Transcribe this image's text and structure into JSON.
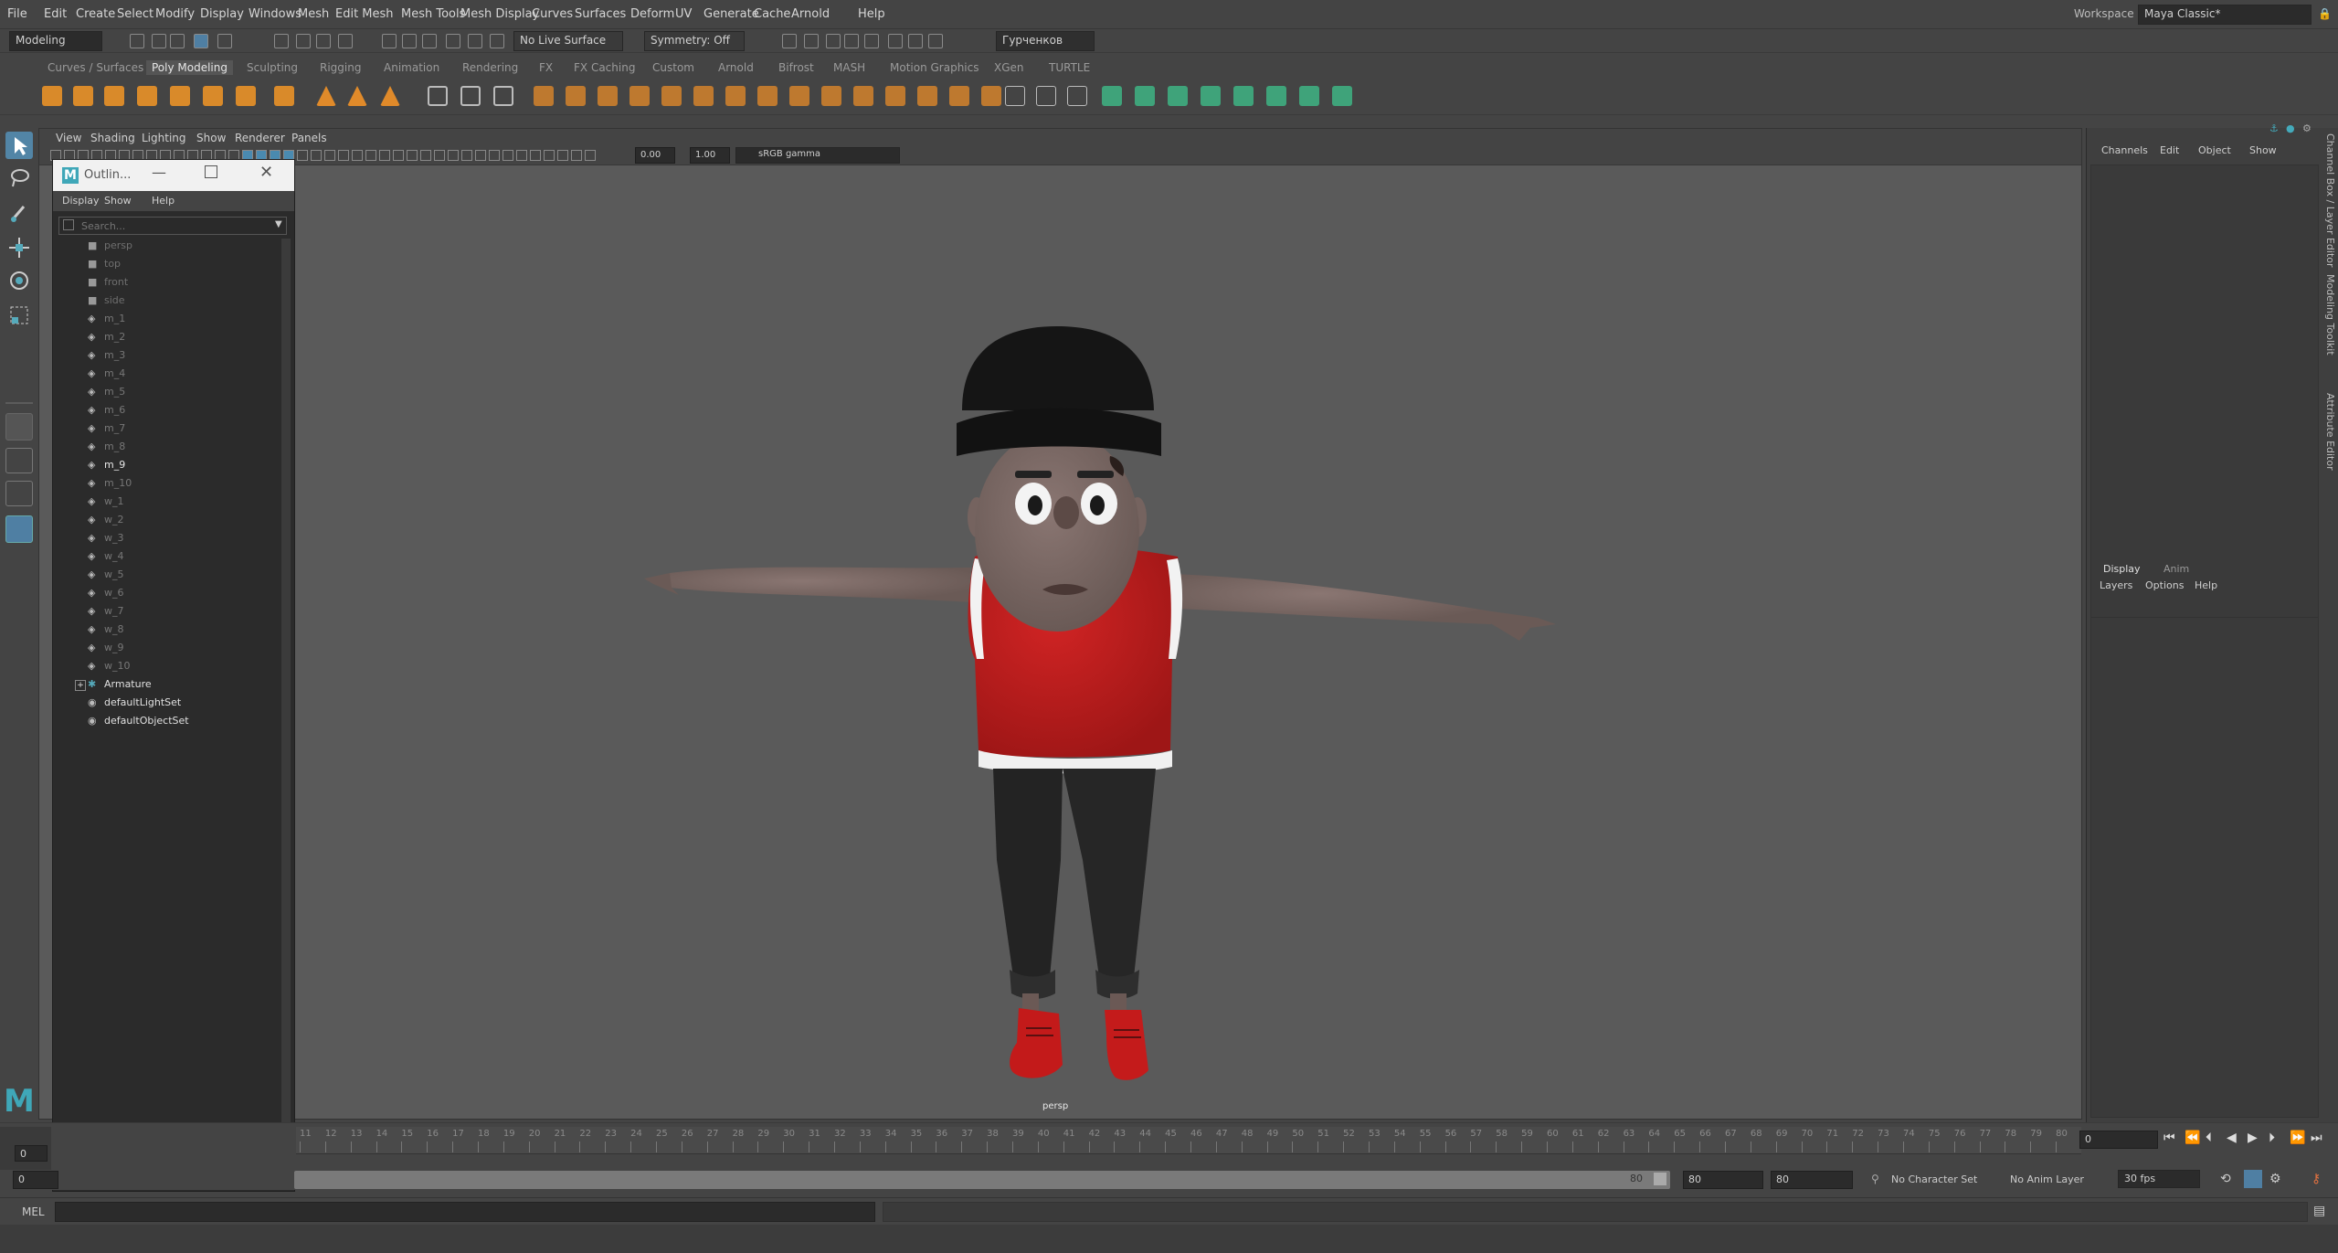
{
  "menus": [
    "File",
    "Edit",
    "Create",
    "Select",
    "Modify",
    "Display",
    "Windows",
    "Mesh",
    "Edit Mesh",
    "Mesh Tools",
    "Mesh Display",
    "Curves",
    "Surfaces",
    "Deform",
    "UV",
    "Generate",
    "Cache",
    "Arnold",
    "Help"
  ],
  "workspace": {
    "label": "Workspace :",
    "value": "Maya Classic*"
  },
  "status": {
    "mode": "Modeling",
    "live": "No Live Surface",
    "symmetry": "Symmetry: Off",
    "user": "Гурченков"
  },
  "shelf_tabs": [
    "Curves / Surfaces",
    "Poly Modeling",
    "Sculpting",
    "Rigging",
    "Animation",
    "Rendering",
    "FX",
    "FX Caching",
    "Custom",
    "Arnold",
    "Bifrost",
    "MASH",
    "Motion Graphics",
    "XGen",
    "TURTLE"
  ],
  "shelf_active": "Poly Modeling",
  "viewport": {
    "menus": [
      "View",
      "Shading",
      "Lighting",
      "Show",
      "Renderer",
      "Panels"
    ],
    "exposure": "0.00",
    "gamma": "1.00",
    "colorspace": "sRGB gamma",
    "camera": "persp"
  },
  "outliner": {
    "title": "Outlin...",
    "menus": [
      "Display",
      "Show",
      "Help"
    ],
    "search_placeholder": "Search...",
    "cameras": [
      "persp",
      "top",
      "front",
      "side"
    ],
    "meshes": [
      "m_1",
      "m_2",
      "m_3",
      "m_4",
      "m_5",
      "m_6",
      "m_7",
      "m_8",
      "m_9",
      "m_10",
      "w_1",
      "w_2",
      "w_3",
      "w_4",
      "w_5",
      "w_6",
      "w_7",
      "w_8",
      "w_9",
      "w_10"
    ],
    "selected": "m_9",
    "others": [
      "Armature",
      "defaultLightSet",
      "defaultObjectSet"
    ]
  },
  "channel_box": {
    "menus": [
      "Channels",
      "Edit",
      "Object",
      "Show"
    ]
  },
  "layer_editor": {
    "tabs": [
      "Display",
      "Anim"
    ],
    "menus": [
      "Layers",
      "Options",
      "Help"
    ]
  },
  "side_tabs": [
    "Channel Box / Layer Editor",
    "Modeling Toolkit",
    "Attribute Editor"
  ],
  "timeline": {
    "ticks": [
      "11",
      "12",
      "13",
      "14",
      "15",
      "16",
      "17",
      "18",
      "19",
      "20",
      "21",
      "22",
      "23",
      "24",
      "25",
      "26",
      "27",
      "28",
      "29",
      "30",
      "31",
      "32",
      "33",
      "34",
      "35",
      "36",
      "37",
      "38",
      "39",
      "40",
      "41",
      "42",
      "43",
      "44",
      "45",
      "46",
      "47",
      "48",
      "49",
      "50",
      "51",
      "52",
      "53",
      "54",
      "55",
      "56",
      "57",
      "58",
      "59",
      "60",
      "61",
      "62",
      "63",
      "64",
      "65",
      "66",
      "67",
      "68",
      "69",
      "70",
      "71",
      "72",
      "73",
      "74",
      "75",
      "76",
      "77",
      "78",
      "79",
      "80"
    ],
    "current": "0",
    "left_frame": "0"
  },
  "range": {
    "start": "0",
    "end_slider": "80",
    "end_a": "80",
    "end_b": "80",
    "char_set": "No Character Set",
    "anim_layer": "No Anim Layer",
    "fps": "30 fps"
  },
  "cmd": {
    "lang": "MEL"
  }
}
